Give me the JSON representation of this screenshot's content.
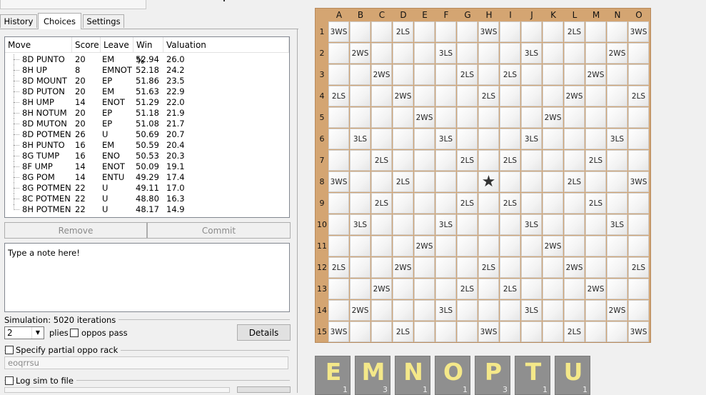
{
  "tabs": [
    "History",
    "Choices",
    "Settings"
  ],
  "columns": [
    "Move",
    "Score",
    "Leave",
    "Win %",
    "Valuation"
  ],
  "moves": [
    {
      "move": "8D PUNTO",
      "score": "20",
      "leave": "EM",
      "win": "52.94",
      "val": "26.0"
    },
    {
      "move": "8H UP",
      "score": "8",
      "leave": "EMNOT",
      "win": "52.18",
      "val": "24.2"
    },
    {
      "move": "8D MOUNT",
      "score": "20",
      "leave": "EP",
      "win": "51.86",
      "val": "23.5"
    },
    {
      "move": "8D PUTON",
      "score": "20",
      "leave": "EM",
      "win": "51.63",
      "val": "22.9"
    },
    {
      "move": "8H UMP",
      "score": "14",
      "leave": "ENOT",
      "win": "51.29",
      "val": "22.0"
    },
    {
      "move": "8H NOTUM",
      "score": "20",
      "leave": "EP",
      "win": "51.18",
      "val": "21.9"
    },
    {
      "move": "8D MUTON",
      "score": "20",
      "leave": "EP",
      "win": "51.08",
      "val": "21.7"
    },
    {
      "move": "8D POTMEN",
      "score": "26",
      "leave": "U",
      "win": "50.69",
      "val": "20.7"
    },
    {
      "move": "8H PUNTO",
      "score": "16",
      "leave": "EM",
      "win": "50.59",
      "val": "20.4"
    },
    {
      "move": "8G TUMP",
      "score": "16",
      "leave": "ENO",
      "win": "50.53",
      "val": "20.3"
    },
    {
      "move": "8F UMP",
      "score": "14",
      "leave": "ENOT",
      "win": "50.09",
      "val": "19.1"
    },
    {
      "move": "8G POM",
      "score": "14",
      "leave": "ENTU",
      "win": "49.29",
      "val": "17.4"
    },
    {
      "move": "8G POTMEN",
      "score": "22",
      "leave": "U",
      "win": "49.11",
      "val": "17.0"
    },
    {
      "move": "8C POTMEN",
      "score": "22",
      "leave": "U",
      "win": "48.80",
      "val": "16.3"
    },
    {
      "move": "8H POTMEN",
      "score": "22",
      "leave": "U",
      "win": "48.17",
      "val": "14.9"
    }
  ],
  "buttons": {
    "remove": "Remove",
    "commit": "Commit",
    "details": "Details"
  },
  "note": "Type a note here!",
  "simulation": {
    "label": "Simulation: 5020 iterations",
    "plies_value": "2",
    "plies_label": "plies",
    "oppos_pass": "oppos pass"
  },
  "partial_rack": {
    "label": "Specify partial oppo rack",
    "value": "eoqrrsu"
  },
  "log_sim": {
    "label": "Log sim to file"
  },
  "board": {
    "col_labels": [
      "A",
      "B",
      "C",
      "D",
      "E",
      "F",
      "G",
      "H",
      "I",
      "J",
      "K",
      "L",
      "M",
      "N",
      "O"
    ],
    "row_labels": [
      "1",
      "2",
      "3",
      "4",
      "5",
      "6",
      "7",
      "8",
      "9",
      "10",
      "11",
      "12",
      "13",
      "14",
      "15"
    ],
    "premiums": [
      [
        "3WS",
        "",
        "",
        "2LS",
        "",
        "",
        "",
        "3WS",
        "",
        "",
        "",
        "2LS",
        "",
        "",
        "3WS"
      ],
      [
        "",
        "2WS",
        "",
        "",
        "",
        "3LS",
        "",
        "",
        "",
        "3LS",
        "",
        "",
        "",
        "2WS",
        ""
      ],
      [
        "",
        "",
        "2WS",
        "",
        "",
        "",
        "2LS",
        "",
        "2LS",
        "",
        "",
        "",
        "2WS",
        "",
        ""
      ],
      [
        "2LS",
        "",
        "",
        "2WS",
        "",
        "",
        "",
        "2LS",
        "",
        "",
        "",
        "2WS",
        "",
        "",
        "2LS"
      ],
      [
        "",
        "",
        "",
        "",
        "2WS",
        "",
        "",
        "",
        "",
        "",
        "2WS",
        "",
        "",
        "",
        ""
      ],
      [
        "",
        "3LS",
        "",
        "",
        "",
        "3LS",
        "",
        "",
        "",
        "3LS",
        "",
        "",
        "",
        "3LS",
        ""
      ],
      [
        "",
        "",
        "2LS",
        "",
        "",
        "",
        "2LS",
        "",
        "2LS",
        "",
        "",
        "",
        "2LS",
        "",
        ""
      ],
      [
        "3WS",
        "",
        "",
        "2LS",
        "",
        "",
        "",
        "★",
        "",
        "",
        "",
        "2LS",
        "",
        "",
        "3WS"
      ],
      [
        "",
        "",
        "2LS",
        "",
        "",
        "",
        "2LS",
        "",
        "2LS",
        "",
        "",
        "",
        "2LS",
        "",
        ""
      ],
      [
        "",
        "3LS",
        "",
        "",
        "",
        "3LS",
        "",
        "",
        "",
        "3LS",
        "",
        "",
        "",
        "3LS",
        ""
      ],
      [
        "",
        "",
        "",
        "",
        "2WS",
        "",
        "",
        "",
        "",
        "",
        "2WS",
        "",
        "",
        "",
        ""
      ],
      [
        "2LS",
        "",
        "",
        "2WS",
        "",
        "",
        "",
        "2LS",
        "",
        "",
        "",
        "2WS",
        "",
        "",
        "2LS"
      ],
      [
        "",
        "",
        "2WS",
        "",
        "",
        "",
        "2LS",
        "",
        "2LS",
        "",
        "",
        "",
        "2WS",
        "",
        ""
      ],
      [
        "",
        "2WS",
        "",
        "",
        "",
        "3LS",
        "",
        "",
        "",
        "3LS",
        "",
        "",
        "",
        "2WS",
        ""
      ],
      [
        "3WS",
        "",
        "",
        "2LS",
        "",
        "",
        "",
        "3WS",
        "",
        "",
        "",
        "2LS",
        "",
        "",
        "3WS"
      ]
    ]
  },
  "rack": [
    {
      "letter": "E",
      "score": "1"
    },
    {
      "letter": "M",
      "score": "3"
    },
    {
      "letter": "N",
      "score": "1"
    },
    {
      "letter": "O",
      "score": "1"
    },
    {
      "letter": "P",
      "score": "3"
    },
    {
      "letter": "T",
      "score": "1"
    },
    {
      "letter": "U",
      "score": "1"
    }
  ]
}
